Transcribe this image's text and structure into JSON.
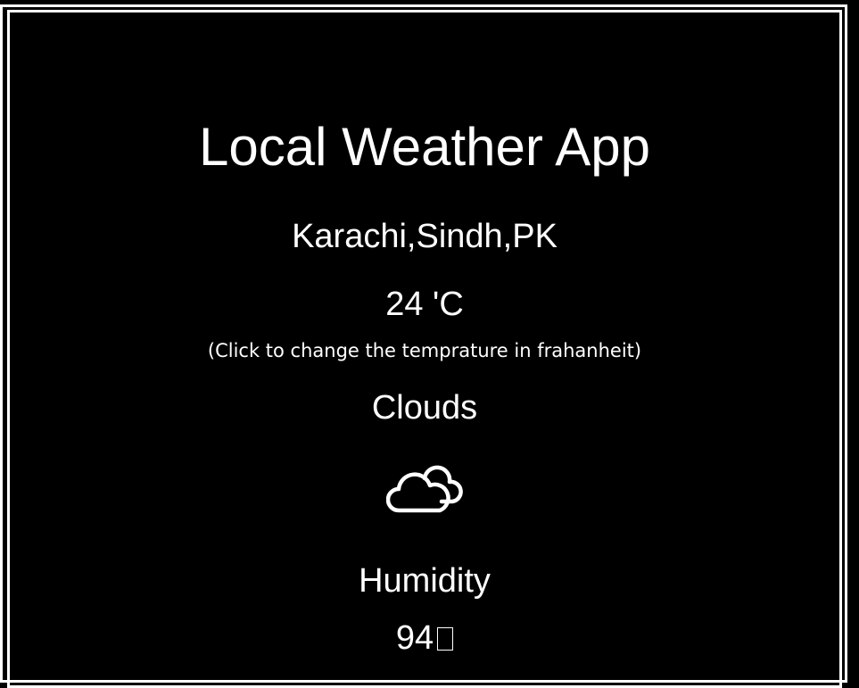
{
  "app": {
    "title": "Local Weather App"
  },
  "weather": {
    "location": "Karachi,Sindh,PK",
    "temperature": "24 'C",
    "temperature_hint": "(Click to change the temprature in frahanheit)",
    "condition": "Clouds",
    "condition_icon": "cloud-icon",
    "humidity_label": "Humidity",
    "humidity_value": "94"
  },
  "colors": {
    "background": "#000000",
    "foreground": "#ffffff"
  }
}
